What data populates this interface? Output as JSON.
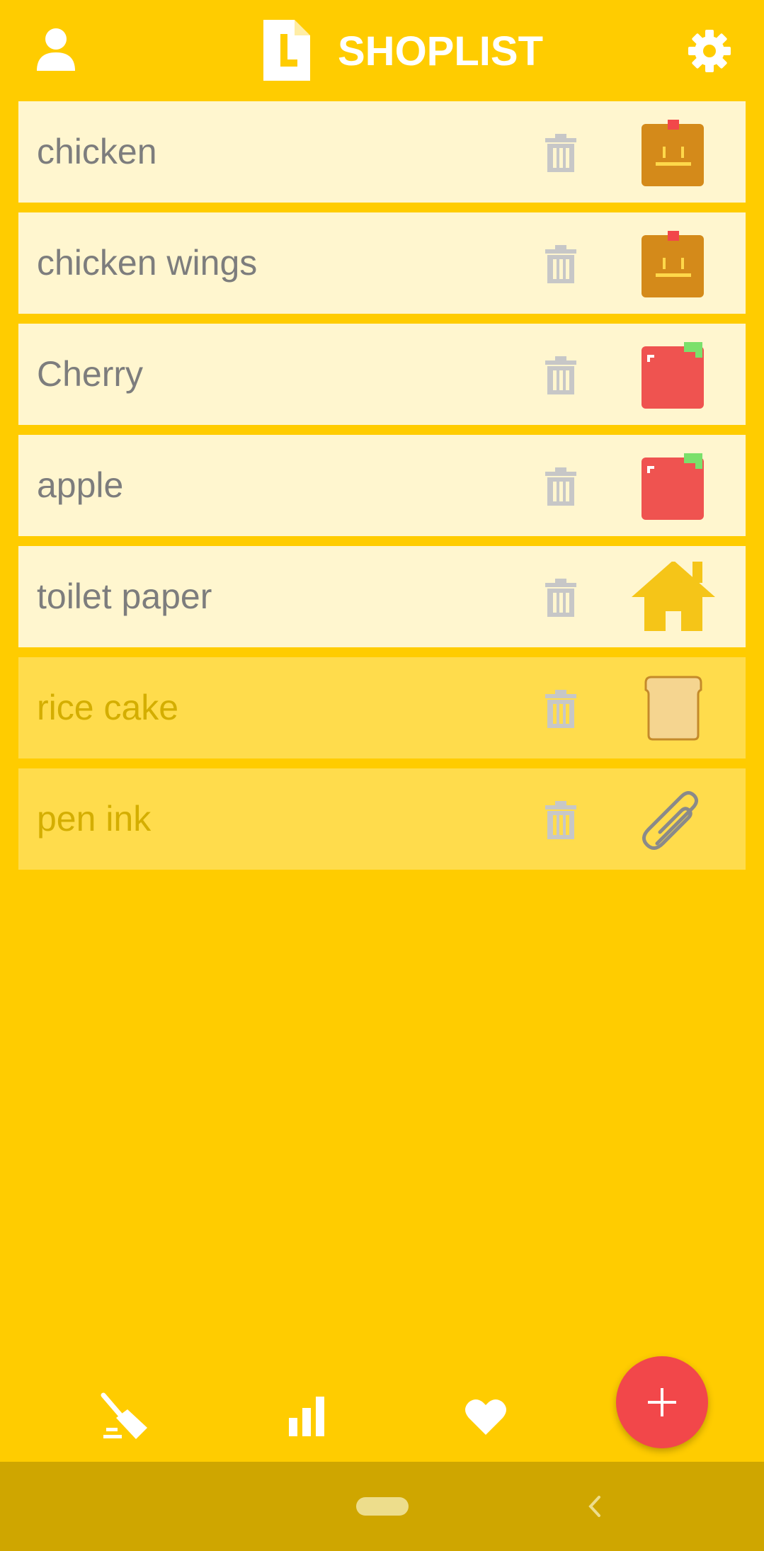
{
  "header": {
    "title": "SHOPLIST",
    "profile_icon": "person-icon",
    "logo_icon": "document-logo-icon",
    "settings_icon": "gear-icon"
  },
  "items": [
    {
      "label": "chicken",
      "category_icon": "meat-box-icon",
      "checked": false
    },
    {
      "label": "chicken wings",
      "category_icon": "meat-box-icon",
      "checked": false
    },
    {
      "label": "Cherry",
      "category_icon": "fruit-icon",
      "checked": false
    },
    {
      "label": "apple",
      "category_icon": "fruit-icon",
      "checked": false
    },
    {
      "label": "toilet paper",
      "category_icon": "home-icon",
      "checked": false
    },
    {
      "label": "rice cake",
      "category_icon": "bread-icon",
      "checked": true
    },
    {
      "label": "pen ink",
      "category_icon": "paperclip-icon",
      "checked": true
    }
  ],
  "bottom_nav": {
    "clean_icon": "broom-icon",
    "stats_icon": "bar-chart-icon",
    "favorites_icon": "heart-icon",
    "add_icon": "plus-icon"
  },
  "colors": {
    "background": "#FFCC00",
    "item_unchecked": "#FFF6CF",
    "item_checked": "#FFDC4C",
    "fab": "#F2474A",
    "system_bar": "#CFA600"
  }
}
